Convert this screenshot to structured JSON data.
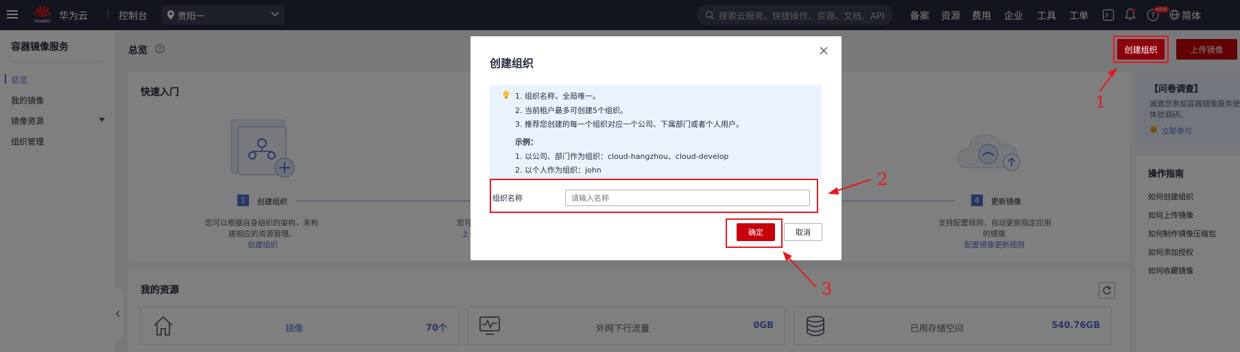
{
  "topbar": {
    "logo_text": "HUAWEI",
    "brand": "华为云",
    "console": "控制台",
    "region": "贵阳一",
    "search_placeholder": "搜索云服务、快捷操作、资源、文档、API",
    "nav": [
      "备案",
      "资源",
      "费用",
      "企业",
      "工具",
      "工单"
    ],
    "new_badge": "NEW",
    "lang": "简体"
  },
  "sidebar": {
    "title": "容器镜像服务",
    "items": [
      {
        "label": "总览",
        "active": true
      },
      {
        "label": "我的镜像"
      },
      {
        "label": "镜像资源"
      },
      {
        "label": "组织管理"
      }
    ]
  },
  "page": {
    "title": "总览",
    "create_org_btn": "创建组织",
    "upload_btn": "上传镜像"
  },
  "quickstart": {
    "title": "快速入门",
    "step1": {
      "num": "1",
      "label": "创建组织",
      "desc1": "您可以根据自身组织的架构，来构",
      "desc2": "建相应的资源管理。",
      "link": "创建组织"
    },
    "step2_fragment": {
      "desc": "您可",
      "link": "上"
    },
    "step4": {
      "num": "4",
      "label": "更新镜像",
      "desc1": "支持配置规则，自动更新指定应用",
      "desc2": "的镜像",
      "link": "配置镜像更新规则"
    }
  },
  "resources": {
    "title": "我的资源",
    "items": [
      {
        "label": "镜像",
        "value": "70个"
      },
      {
        "label": "外网下行流量",
        "value": "0GB"
      },
      {
        "label": "已用存储空间",
        "value": "540.76GB"
      }
    ]
  },
  "survey": {
    "title": "【问卷调查】",
    "text1": "诚邀您参加容器镜像服务使用",
    "text2": "体验调研。",
    "link": "立即参与"
  },
  "guide": {
    "title": "操作指南",
    "items": [
      "如何创建组织",
      "如何上传镜像",
      "如何制作镜像压缩包",
      "如何添加授权",
      "如何收藏镜像"
    ]
  },
  "dialog": {
    "title": "创建组织",
    "tips": [
      "1. 组织名称，全局唯一。",
      "2. 当前租户最多可创建5个组织。",
      "3. 推荐您创建的每一个组织对应一个公司、下属部门或者个人用户。"
    ],
    "example_title": "示例：",
    "examples": [
      "1. 以公司、部门作为组织：cloud-hangzhou、cloud-develop",
      "2. 以个人作为组织：john"
    ],
    "field_label": "组织名称",
    "field_placeholder": "请输入名称",
    "field_value": "",
    "ok": "确定",
    "cancel": "取消"
  },
  "annotations": [
    "1",
    "2",
    "3"
  ],
  "colors": {
    "brand_red": "#c7000b",
    "topbar": "#252b3a",
    "link_blue": "#526ecc",
    "annotation_red": "#e8161e"
  }
}
